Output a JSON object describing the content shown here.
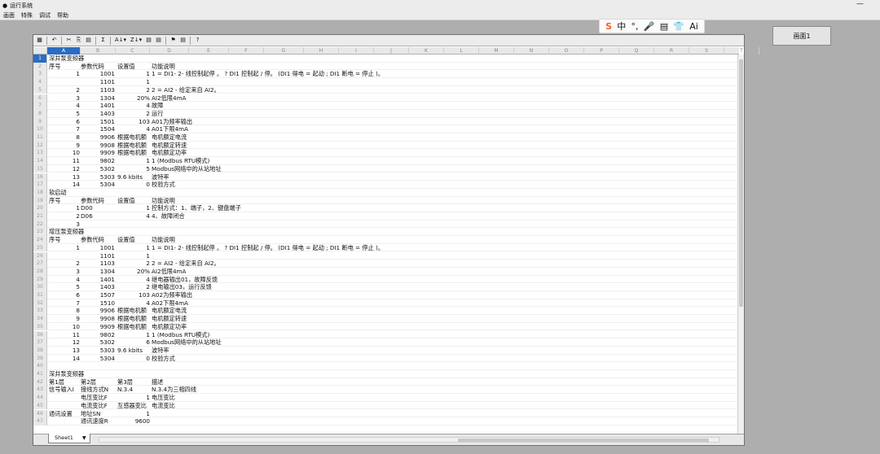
{
  "window": {
    "title": "运行系统",
    "minimize": "—"
  },
  "menu": [
    "画面",
    "特殊",
    "调试",
    "帮助"
  ],
  "ime": {
    "items": [
      "S",
      "中",
      "°,",
      "🎤",
      "▤",
      "👕",
      "Ai"
    ]
  },
  "screen_button": "画面1",
  "toolbar": {
    "icons": [
      "▦",
      "↶",
      "✂",
      "⎘",
      "▤",
      "Σ",
      "A↓▾",
      "Z↓▾",
      "▤",
      "▤",
      "⚑",
      "▤",
      "?"
    ]
  },
  "columns": [
    "A",
    "B",
    "C",
    "D",
    "E",
    "F",
    "G",
    "H",
    "I",
    "J",
    "K",
    "L",
    "M",
    "N",
    "O",
    "P",
    "Q",
    "R",
    "S",
    "T"
  ],
  "rows": [
    {
      "n": "1",
      "a": "深井泵变频器"
    },
    {
      "n": "2",
      "a": "序号",
      "b": "参数代码",
      "c": "设置值",
      "d": "功能说明"
    },
    {
      "n": "3",
      "ar": "1",
      "br": "1001",
      "cr": "1",
      "d": "1 = DI1- 2- 线控制起停 。 ? DI1 控制起 / 停。 (DI1 得电 = 起动 ; DI1 断电 = 停止 )。"
    },
    {
      "n": "4",
      "br": "1101",
      "cr": "1"
    },
    {
      "n": "5",
      "ar": "2",
      "br": "1103",
      "cr": "2",
      "d": "2 = AI2 - 给定来自 AI2。"
    },
    {
      "n": "6",
      "ar": "3",
      "br": "1304",
      "cr": "20%",
      "d": "AI2低限4mA"
    },
    {
      "n": "7",
      "ar": "4",
      "br": "1401",
      "cr": "4",
      "d": "故障"
    },
    {
      "n": "8",
      "ar": "5",
      "br": "1403",
      "cr": "2",
      "d": "运行"
    },
    {
      "n": "9",
      "ar": "6",
      "br": "1501",
      "cr": "103",
      "d": "A01为频率输出"
    },
    {
      "n": "10",
      "ar": "7",
      "br": "1504",
      "cr": "4",
      "d": "A01下限4mA"
    },
    {
      "n": "11",
      "ar": "8",
      "br": "9906",
      "c": "根据电机额",
      "d": "电机额定电流"
    },
    {
      "n": "12",
      "ar": "9",
      "br": "9908",
      "c": "根据电机额",
      "d": "电机额定转速"
    },
    {
      "n": "13",
      "ar": "10",
      "br": "9909",
      "c": "根据电机额",
      "d": "电机额定功率"
    },
    {
      "n": "14",
      "ar": "11",
      "br": "9802",
      "cr": "1",
      "d": "1 (Modbus RTU模式)"
    },
    {
      "n": "15",
      "ar": "12",
      "br": "5302",
      "cr": "5",
      "d": "Modbus网络中的从站地址"
    },
    {
      "n": "16",
      "ar": "13",
      "br": "5303",
      "c": "9.6 kbits",
      "d": "波特率"
    },
    {
      "n": "17",
      "ar": "14",
      "br": "5304",
      "cr": "0",
      "d": "校验方式"
    },
    {
      "n": "18",
      "a": "软启动"
    },
    {
      "n": "19",
      "a": "序号",
      "b": "参数代码",
      "c": "设置值",
      "d": "功能说明"
    },
    {
      "n": "20",
      "ar": "1",
      "b": "D00",
      "cr": "1",
      "d": "控制方式：1、端子，2、键盘端子"
    },
    {
      "n": "21",
      "ar": "2",
      "b": "D06",
      "cr": "4",
      "d": "4、故障闭合"
    },
    {
      "n": "22",
      "ar": "3"
    },
    {
      "n": "23",
      "a": "增压泵变频器"
    },
    {
      "n": "24",
      "a": "序号",
      "b": "参数代码",
      "c": "设置值",
      "d": "功能说明"
    },
    {
      "n": "25",
      "ar": "1",
      "br": "1001",
      "cr": "1",
      "d": "1 = DI1- 2- 线控制起停 。 ? DI1 控制起 / 停。 (DI1 得电 = 起动 ; DI1 断电 = 停止 )。"
    },
    {
      "n": "26",
      "br": "1101",
      "cr": "1"
    },
    {
      "n": "27",
      "ar": "2",
      "br": "1103",
      "cr": "2",
      "d": "2 = AI2 - 给定来自 AI2。"
    },
    {
      "n": "28",
      "ar": "3",
      "br": "1304",
      "cr": "20%",
      "d": "AI2低限4mA"
    },
    {
      "n": "29",
      "ar": "4",
      "br": "1401",
      "cr": "4",
      "d": "继电器输出01，故障反馈"
    },
    {
      "n": "30",
      "ar": "5",
      "br": "1403",
      "cr": "2",
      "d": "继电输出03，运行反馈"
    },
    {
      "n": "31",
      "ar": "6",
      "br": "1507",
      "cr": "103",
      "d": "A02为频率输出"
    },
    {
      "n": "32",
      "ar": "7",
      "br": "1510",
      "cr": "4",
      "d": "A02下限4mA"
    },
    {
      "n": "33",
      "ar": "8",
      "br": "9906",
      "c": "根据电机额",
      "d": "电机额定电流"
    },
    {
      "n": "34",
      "ar": "9",
      "br": "9908",
      "c": "根据电机额",
      "d": "电机额定转速"
    },
    {
      "n": "35",
      "ar": "10",
      "br": "9909",
      "c": "根据电机额",
      "d": "电机额定功率"
    },
    {
      "n": "36",
      "ar": "11",
      "br": "9802",
      "cr": "1",
      "d": "1 (Modbus RTU模式)"
    },
    {
      "n": "37",
      "ar": "12",
      "br": "5302",
      "cr": "6",
      "d": "Modbus网络中的从站地址"
    },
    {
      "n": "38",
      "ar": "13",
      "br": "5303",
      "c": "9.6 kbits",
      "d": "波特率"
    },
    {
      "n": "39",
      "ar": "14",
      "br": "5304",
      "cr": "0",
      "d": "校验方式"
    },
    {
      "n": "40"
    },
    {
      "n": "41",
      "a": "深井泵变频器"
    },
    {
      "n": "42",
      "a": "第1层",
      "b": "第2层",
      "c": "第3层",
      "d": "描述"
    },
    {
      "n": "43",
      "a": "信号输入I",
      "b": "接线方式N",
      "c": "N.3.4",
      "d": "N.3.4为三相四线"
    },
    {
      "n": "44",
      "b": "电压变比F",
      "cr": "1",
      "d": "电压变比"
    },
    {
      "n": "45",
      "b": "电流变比F",
      "c": "互感器变比",
      "d": "电流变比"
    },
    {
      "n": "46",
      "a": "通讯设置",
      "b": "地址SN",
      "cr": "1"
    },
    {
      "n": "47",
      "b": "通讯速度R",
      "cr": "9600"
    }
  ],
  "sheet_tab": "Sheet1"
}
